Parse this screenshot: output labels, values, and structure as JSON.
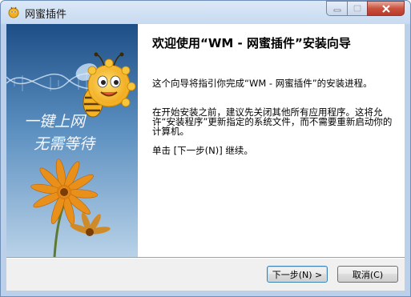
{
  "window": {
    "title": "网蜜插件"
  },
  "side_image": {
    "slogan_line1": "一键上网",
    "slogan_line2": "无需等待"
  },
  "content": {
    "heading": "欢迎使用“WM - 网蜜插件”安装向导",
    "paragraphs": [
      "这个向导将指引你完成“WM - 网蜜插件”的安装进程。",
      "在开始安装之前，建议先关闭其他所有应用程序。这将允许“安装程序”更新指定的系统文件，而不需要重新启动你的计算机。",
      "单击 [下一步(N)] 继续。"
    ]
  },
  "buttons": {
    "next": "下一步(N) >",
    "cancel": "取消(C)"
  },
  "colors": {
    "title_bar": "#c9dbf1",
    "side_bg": "#3e6c9b",
    "close_button": "#c9533f"
  }
}
